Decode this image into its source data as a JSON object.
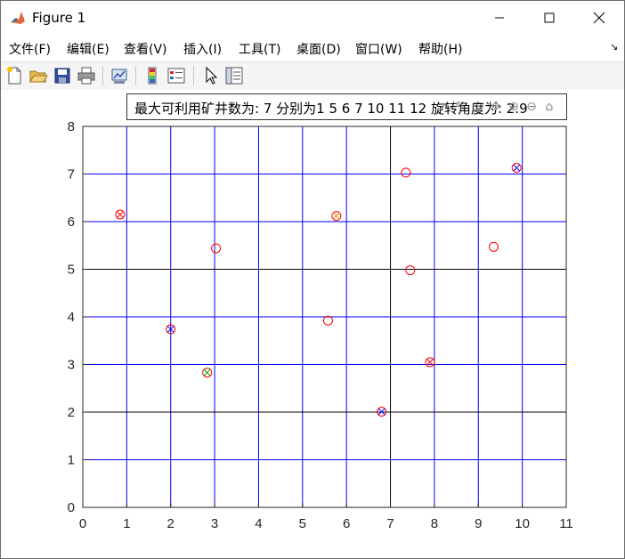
{
  "window": {
    "title": "Figure 1"
  },
  "menu": [
    "文件(F)",
    "编辑(E)",
    "查看(V)",
    "插入(I)",
    "工具(T)",
    "桌面(D)",
    "窗口(W)",
    "帮助(H)"
  ],
  "toolbar": {
    "icons": [
      "new-figure-icon",
      "open-file-icon",
      "save-icon",
      "print-icon",
      "link-plot-icon",
      "insert-colorbar-icon",
      "insert-legend-icon",
      "pointer-icon",
      "property-inspector-icon"
    ]
  },
  "figure": {
    "title_text": "最大可利用矿井数为: 7 分别为1 5 6 7 10 11 12  旋转角度为: 2.9"
  },
  "chart_data": {
    "type": "scatter",
    "title": "最大可利用矿井数为: 7 分别为1 5 6 7 10 11 12  旋转角度为: 2.9",
    "xlim": [
      0,
      11
    ],
    "ylim": [
      0,
      8
    ],
    "xticks": [
      0,
      1,
      2,
      3,
      4,
      5,
      6,
      7,
      8,
      9,
      10,
      11
    ],
    "yticks": [
      0,
      1,
      2,
      3,
      4,
      5,
      6,
      7,
      8
    ],
    "grid": true,
    "colors": {
      "grid_blue": "#0000ff",
      "grid_black": "#000000",
      "circle": "#ff0000",
      "cross_blue": "#0000ff",
      "cross_orange": "#ff8800",
      "cross_green": "#00a000",
      "cross_red": "#ff0000"
    },
    "points": [
      {
        "x": 0.85,
        "y": 6.15,
        "cross": "red"
      },
      {
        "x": 2.0,
        "y": 3.74,
        "cross": "blue"
      },
      {
        "x": 2.83,
        "y": 2.83,
        "cross": "green"
      },
      {
        "x": 3.03,
        "y": 5.44,
        "cross": null
      },
      {
        "x": 5.58,
        "y": 3.92,
        "cross": null
      },
      {
        "x": 5.77,
        "y": 6.12,
        "cross": "orange"
      },
      {
        "x": 6.8,
        "y": 2.01,
        "cross": "blue"
      },
      {
        "x": 7.35,
        "y": 7.03,
        "cross": null
      },
      {
        "x": 7.45,
        "y": 4.98,
        "cross": null
      },
      {
        "x": 7.9,
        "y": 3.05,
        "cross": "red"
      },
      {
        "x": 9.35,
        "y": 5.47,
        "cross": null
      },
      {
        "x": 9.87,
        "y": 7.13,
        "cross": "blue"
      }
    ]
  }
}
